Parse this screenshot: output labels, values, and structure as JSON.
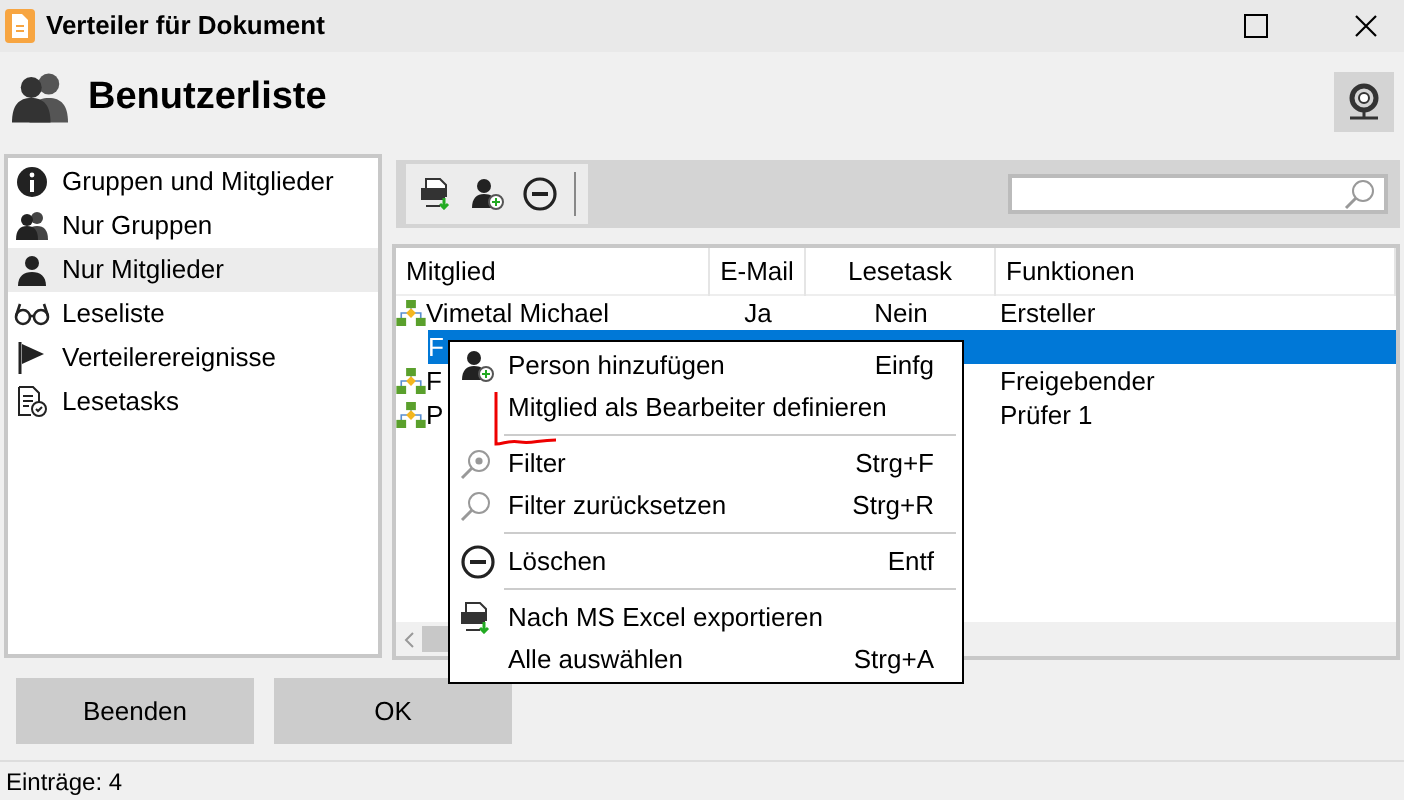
{
  "window": {
    "title": "Verteiler für Dokument"
  },
  "header": {
    "title": "Benutzerliste"
  },
  "sidebar": {
    "items": [
      {
        "label": "Gruppen und Mitglieder",
        "selected": false
      },
      {
        "label": "Nur Gruppen",
        "selected": false
      },
      {
        "label": "Nur Mitglieder",
        "selected": true
      },
      {
        "label": "Leseliste",
        "selected": false
      },
      {
        "label": "Verteilerereignisse",
        "selected": false
      },
      {
        "label": "Lesetasks",
        "selected": false
      }
    ]
  },
  "table": {
    "columns": [
      "Mitglied",
      "E-Mail",
      "Lesetask",
      "Funktionen"
    ],
    "rows": [
      {
        "kind": "group",
        "selected": false,
        "cells": [
          "Vimetal Michael",
          "Ja",
          "Nein",
          "Ersteller"
        ]
      },
      {
        "kind": "member",
        "selected": true,
        "cells": [
          "F"
        ]
      },
      {
        "kind": "group",
        "selected": false,
        "cells": [
          "F",
          "",
          "",
          "Freigebender"
        ]
      },
      {
        "kind": "group",
        "selected": false,
        "cells": [
          "P",
          "",
          "",
          "Prüfer 1"
        ]
      }
    ]
  },
  "context_menu": {
    "items": [
      {
        "kind": "item",
        "label": "Person hinzufügen",
        "shortcut": "Einfg"
      },
      {
        "kind": "item",
        "label": "Mitglied als Bearbeiter definieren"
      },
      {
        "kind": "separator"
      },
      {
        "kind": "item",
        "label": "Filter",
        "shortcut": "Strg+F"
      },
      {
        "kind": "item",
        "label": "Filter zurücksetzen",
        "shortcut": "Strg+R"
      },
      {
        "kind": "separator"
      },
      {
        "kind": "item",
        "label": "Löschen",
        "shortcut": "Entf"
      },
      {
        "kind": "separator"
      },
      {
        "kind": "item",
        "label": "Nach MS Excel exportieren"
      },
      {
        "kind": "item",
        "label": "Alle auswählen",
        "shortcut": "Strg+A"
      }
    ]
  },
  "buttons": [
    "Beenden",
    "OK"
  ],
  "status_bar": "Einträge: 4"
}
